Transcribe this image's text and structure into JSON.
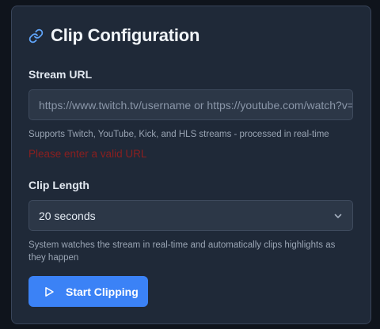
{
  "card": {
    "title": "Clip Configuration",
    "title_icon": "link-icon"
  },
  "stream_url": {
    "label": "Stream URL",
    "placeholder": "https://www.twitch.tv/username or https://youtube.com/watch?v=...",
    "value": "",
    "hint": "Supports Twitch, YouTube, Kick, and HLS streams - processed in real-time",
    "error": "Please enter a valid URL"
  },
  "clip_length": {
    "label": "Clip Length",
    "selected": "20 seconds",
    "icon": "chevron-down-icon",
    "hint": "System watches the stream in real-time and automatically clips highlights as they happen"
  },
  "start_button": {
    "label": "Start Clipping",
    "icon": "play-icon"
  },
  "colors": {
    "page_bg": "#0f141c",
    "card_bg": "#1f2938",
    "accent": "#3b82f6",
    "error": "#8b1f1f",
    "link_icon": "#60a5fa"
  }
}
